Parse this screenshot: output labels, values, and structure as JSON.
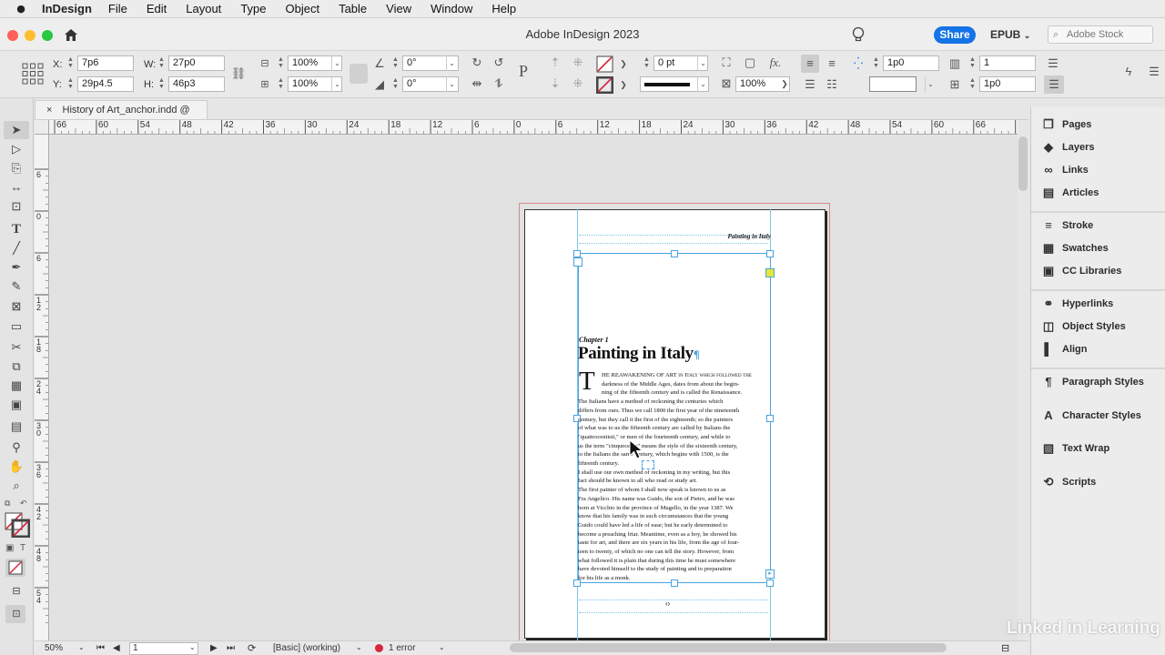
{
  "menubar": {
    "app_name": "InDesign",
    "items": [
      "File",
      "Edit",
      "Layout",
      "Type",
      "Object",
      "Table",
      "View",
      "Window",
      "Help"
    ]
  },
  "titlebar": {
    "title": "Adobe InDesign 2023",
    "share_label": "Share",
    "workspace_label": "EPUB",
    "search_placeholder": "Adobe Stock"
  },
  "control": {
    "x_label": "X:",
    "x_value": "7p6",
    "y_label": "Y:",
    "y_value": "29p4.5",
    "w_label": "W:",
    "w_value": "27p0",
    "h_label": "H:",
    "h_value": "46p3",
    "scale_x": "100%",
    "scale_y": "100%",
    "rotate": "0°",
    "shear": "0°",
    "stroke_weight": "0 pt",
    "opacity": "100%",
    "gutter": "1p0",
    "columns": "1",
    "inset": "1p0"
  },
  "document": {
    "tab_label": "History of Art_anchor.indd @ 50%",
    "ruler_h": [
      "66",
      "60",
      "54",
      "48",
      "42",
      "36",
      "30",
      "24",
      "18",
      "12",
      "6",
      "0",
      "6",
      "12",
      "18",
      "24",
      "30",
      "36",
      "42",
      "48",
      "54",
      "60",
      "66",
      "72"
    ],
    "ruler_v": [
      "6",
      "0",
      "6",
      "1 2",
      "1 8",
      "2 4",
      "3 0",
      "3 6",
      "4 2",
      "4 8",
      "5 4"
    ]
  },
  "page": {
    "running_head": "Painting in Italy",
    "chapter": "Chapter 1",
    "heading": "Painting in Italy",
    "dropcap": "T",
    "lines": [
      "HE REAWAKENING OF ART in Italy which followed the",
      "darkness of the Middle Ages, dates from about the begin-",
      "ning of the fifteenth century and is called the Renaissance.",
      "The Italians have a method of reckoning the centuries which",
      "differs from ours. Thus we call 1800 the first year of the nineteenth",
      "century, but they call it the first of the eighteenth; so the painters",
      "of what was to us the fifteenth century are called by Italians the",
      "\"quattrocentisti,\" or men of the fourteenth century, and while to",
      "us the term \"cinquecento\" means the style of the sixteenth century,",
      "to the Italians the same century, which begins with 1500, is the",
      "fifteenth century.",
      "  I shall use our own method of reckoning in my writing, but this",
      "fact should be known to all who read or study art.",
      "  The first painter of whom I shall now speak is known to us as",
      "Fra Angelico. His name was Guido, the son of Pietro, and he was",
      "born at Vicchio in the province of Mugello, in the year 1387. We",
      "know that his family was in such circumstances that the young",
      "Guido could have led a life of ease; but he early determined to",
      "become a preaching friar. Meantime, even as a boy, he showed his",
      "taste for art, and there are six years in his life, from the age of four-",
      "teen to twenty, of which no one can tell the story. However, from",
      "what followed it is plain that during this time he must somewhere",
      "have devoted himself to the study of painting and to preparation",
      "for his life as a monk."
    ]
  },
  "status": {
    "zoom": "50%",
    "page_number": "1",
    "style": "[Basic] (working)",
    "errors": "1 error"
  },
  "panels": {
    "group1": [
      {
        "label": "Pages",
        "icon": "pages-icon"
      },
      {
        "label": "Layers",
        "icon": "layers-icon"
      },
      {
        "label": "Links",
        "icon": "links-icon"
      },
      {
        "label": "Articles",
        "icon": "articles-icon"
      }
    ],
    "group2": [
      {
        "label": "Stroke",
        "icon": "stroke-icon"
      },
      {
        "label": "Swatches",
        "icon": "swatches-icon"
      },
      {
        "label": "CC Libraries",
        "icon": "cc-libraries-icon"
      }
    ],
    "group3": [
      {
        "label": "Hyperlinks",
        "icon": "hyperlinks-icon"
      },
      {
        "label": "Object Styles",
        "icon": "object-styles-icon"
      },
      {
        "label": "Align",
        "icon": "align-icon"
      }
    ],
    "group4": [
      {
        "label": "Paragraph Styles",
        "icon": "paragraph-styles-icon"
      },
      {
        "label": "Character Styles",
        "icon": "character-styles-icon"
      },
      {
        "label": "Text Wrap",
        "icon": "text-wrap-icon"
      },
      {
        "label": "Scripts",
        "icon": "scripts-icon"
      }
    ]
  },
  "watermark": "Linked in Learning",
  "colors": {
    "accent": "#1473e6",
    "error": "#d7263d",
    "frame_guide": "#4aa3df",
    "bleed": "#d98a8a",
    "anchor_handle": "#e6e63a"
  }
}
